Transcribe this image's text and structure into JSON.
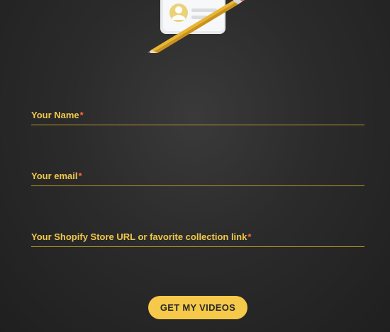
{
  "illustration": {
    "icon": "contact-card-pencil-icon"
  },
  "form": {
    "fields": [
      {
        "label": "Your Name",
        "required_mark": "*"
      },
      {
        "label": "Your email",
        "required_mark": "*"
      },
      {
        "label": "Your Shopify Store URL or favorite collection link",
        "required_mark": "*"
      }
    ],
    "submit_label": "GET MY VIDEOS"
  },
  "colors": {
    "accent": "#f6c94a",
    "label": "#f2c84b",
    "required": "#ff6a3d",
    "background": "#2b2b2b"
  }
}
